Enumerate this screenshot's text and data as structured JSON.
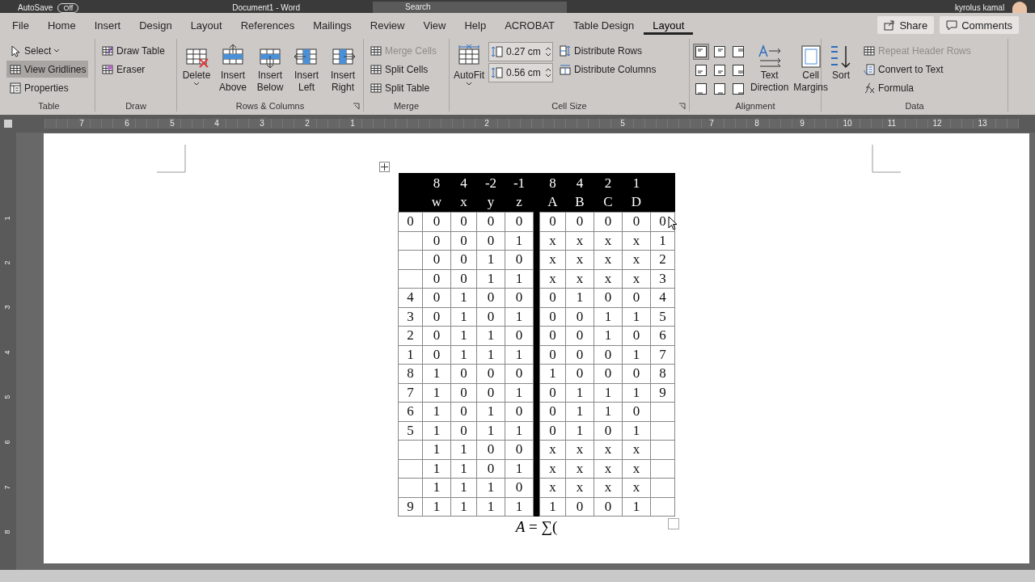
{
  "title_bar": {
    "autosave": "AutoSave",
    "autosave_state": "Off",
    "document": "Document1 - Word",
    "search": "Search",
    "user": "kyrolus kamal"
  },
  "tabs": [
    {
      "label": "File",
      "selected": false
    },
    {
      "label": "Home",
      "selected": false
    },
    {
      "label": "Insert",
      "selected": false
    },
    {
      "label": "Design",
      "selected": false
    },
    {
      "label": "Layout",
      "selected": false
    },
    {
      "label": "References",
      "selected": false
    },
    {
      "label": "Mailings",
      "selected": false
    },
    {
      "label": "Review",
      "selected": false
    },
    {
      "label": "View",
      "selected": false
    },
    {
      "label": "Help",
      "selected": false
    },
    {
      "label": "ACROBAT",
      "selected": false
    },
    {
      "label": "Table Design",
      "selected": false
    },
    {
      "label": "Layout",
      "selected": true
    }
  ],
  "actions": [
    "Share",
    "Comments"
  ],
  "ribbon": {
    "groups": [
      {
        "label": "Table",
        "columns": [
          [
            {
              "kind": "small",
              "label": "Select",
              "dropdown": true,
              "on": false
            },
            {
              "kind": "small",
              "label": "View Gridlines",
              "on": true
            },
            {
              "kind": "small",
              "label": "Properties",
              "on": false
            }
          ]
        ]
      },
      {
        "label": "Draw",
        "columns": [
          [
            {
              "kind": "small",
              "label": "Draw Table"
            },
            {
              "kind": "small",
              "label": "Eraser"
            }
          ]
        ]
      },
      {
        "label": "Rows & Columns",
        "launcher": true,
        "columns": [
          [
            {
              "kind": "large",
              "label": "Delete",
              "dropdown": true
            }
          ],
          [
            {
              "kind": "large",
              "label": "Insert Above"
            }
          ],
          [
            {
              "kind": "large",
              "label": "Insert Below"
            }
          ],
          [
            {
              "kind": "large",
              "label": "Insert Left"
            }
          ],
          [
            {
              "kind": "large",
              "label": "Insert Right"
            }
          ]
        ]
      },
      {
        "label": "Merge",
        "columns": [
          [
            {
              "kind": "small",
              "label": "Merge Cells",
              "disabled": true
            },
            {
              "kind": "small",
              "label": "Split Cells"
            },
            {
              "kind": "small",
              "label": "Split Table"
            }
          ]
        ]
      },
      {
        "label": "Cell Size",
        "launcher": true,
        "columns": [
          [
            {
              "kind": "large",
              "label": "AutoFit",
              "dropdown": true
            }
          ],
          [
            {
              "kind": "spin",
              "value": "0.27 cm"
            },
            {
              "kind": "spin",
              "value": "0.56 cm"
            }
          ],
          [
            {
              "kind": "small",
              "label": "Distribute Rows"
            },
            {
              "kind": "small",
              "label": "Distribute Columns"
            }
          ]
        ]
      },
      {
        "label": "Alignment",
        "columns": [
          [
            {
              "kind": "align",
              "cells": [
                {
                  "selected": true
                },
                {
                  "selected": false
                },
                {
                  "selected": false
                },
                {
                  "selected": false
                },
                {
                  "selected": false
                },
                {
                  "selected": false
                },
                {
                  "selected": false
                },
                {
                  "selected": false
                },
                {
                  "selected": false
                }
              ]
            }
          ],
          [
            {
              "kind": "large",
              "label": "Text Direction"
            }
          ],
          [
            {
              "kind": "large",
              "label": "Cell Margins"
            }
          ]
        ]
      },
      {
        "label": "Data",
        "columns": [
          [
            {
              "kind": "large",
              "label": "Sort"
            }
          ],
          [
            {
              "kind": "small",
              "label": "Repeat Header Rows",
              "disabled": true
            },
            {
              "kind": "small",
              "label": "Convert to Text"
            },
            {
              "kind": "small",
              "label": "Formula"
            }
          ]
        ]
      }
    ]
  },
  "ruler": {
    "horizontal": [
      "7",
      "6",
      "5",
      "4",
      "3",
      "2",
      "1",
      "2",
      "5",
      "7",
      "8",
      "9",
      "10",
      "11",
      "12",
      "13"
    ],
    "vertical": [
      "1",
      "2",
      "3",
      "4",
      "5",
      "6",
      "7",
      "8"
    ]
  },
  "table": {
    "header": [
      {
        "weight": "8",
        "name": "w"
      },
      {
        "weight": "4",
        "name": "x"
      },
      {
        "weight": "-2",
        "name": "y"
      },
      {
        "weight": "-1",
        "name": "z"
      },
      {
        "weight": "8",
        "name": "A"
      },
      {
        "weight": "4",
        "name": "B"
      },
      {
        "weight": "2",
        "name": "C"
      },
      {
        "weight": "1",
        "name": "D"
      }
    ],
    "rows": [
      [
        "0",
        "0",
        "0",
        "0",
        "0",
        "0",
        "0",
        "0",
        "0",
        "0"
      ],
      [
        null,
        "0",
        "0",
        "0",
        "1",
        "x",
        "x",
        "x",
        "x",
        "1"
      ],
      [
        null,
        "0",
        "0",
        "1",
        "0",
        "x",
        "x",
        "x",
        "x",
        "2"
      ],
      [
        null,
        "0",
        "0",
        "1",
        "1",
        "x",
        "x",
        "x",
        "x",
        "3"
      ],
      [
        "4",
        "0",
        "1",
        "0",
        "0",
        "0",
        "1",
        "0",
        "0",
        "4"
      ],
      [
        "3",
        "0",
        "1",
        "0",
        "1",
        "0",
        "0",
        "1",
        "1",
        "5"
      ],
      [
        "2",
        "0",
        "1",
        "1",
        "0",
        "0",
        "0",
        "1",
        "0",
        "6"
      ],
      [
        "1",
        "0",
        "1",
        "1",
        "1",
        "0",
        "0",
        "0",
        "1",
        "7"
      ],
      [
        "8",
        "1",
        "0",
        "0",
        "0",
        "1",
        "0",
        "0",
        "0",
        "8"
      ],
      [
        "7",
        "1",
        "0",
        "0",
        "1",
        "0",
        "1",
        "1",
        "1",
        "9"
      ],
      [
        "6",
        "1",
        "0",
        "1",
        "0",
        "0",
        "1",
        "1",
        "0",
        null
      ],
      [
        "5",
        "1",
        "0",
        "1",
        "1",
        "0",
        "1",
        "0",
        "1",
        null
      ],
      [
        null,
        "1",
        "1",
        "0",
        "0",
        "x",
        "x",
        "x",
        "x",
        null
      ],
      [
        null,
        "1",
        "1",
        "0",
        "1",
        "x",
        "x",
        "x",
        "x",
        null
      ],
      [
        null,
        "1",
        "1",
        "1",
        "0",
        "x",
        "x",
        "x",
        "x",
        null
      ],
      [
        "9",
        "1",
        "1",
        "1",
        "1",
        "1",
        "0",
        "0",
        "1",
        null
      ]
    ]
  },
  "formula": "*A* = ∑("
}
